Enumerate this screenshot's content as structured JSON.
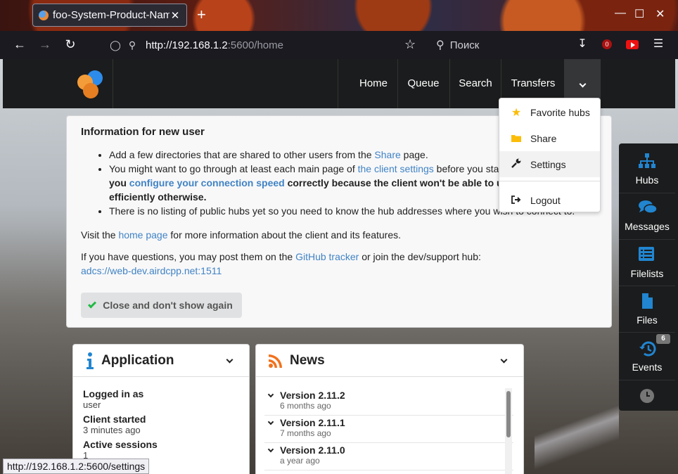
{
  "browser": {
    "tab_title": "foo-System-Product-Name",
    "close_tab": "✕",
    "new_tab": "+",
    "url_host": "http://192.168.1.2",
    "url_rest": ":5600/home",
    "search_placeholder": "Поиск",
    "status_url": "http://192.168.1.2:5600/settings",
    "ublock_count": "0"
  },
  "nav": {
    "items": [
      "Home",
      "Queue",
      "Search",
      "Transfers"
    ]
  },
  "dropdown": {
    "items": [
      {
        "label": "Favorite hubs",
        "icon": "star-icon"
      },
      {
        "label": "Share",
        "icon": "folder-icon"
      },
      {
        "label": "Settings",
        "icon": "wrench-icon"
      },
      {
        "label": "Logout",
        "icon": "sign-out-icon"
      }
    ]
  },
  "info": {
    "title": "Information for new user",
    "b1_pre": "Add a few directories that are shared to other users from the ",
    "b1_link": "Share",
    "b1_post": " page.",
    "b2_pre": "You might want to go through at least each main page of ",
    "b2_link": "the client settings",
    "b2_post": " before you start.",
    "b2_l2_pre": "you ",
    "b2_l2_link": "configure your connection speed",
    "b2_l2_post": " correctly because the client won't be able to utilize y",
    "b2_l3": "efficiently otherwise.",
    "b3_text": "There is no listing of public hubs yet so you need to know the hub addresses where you wish to connect to.",
    "visit_pre": "Visit the ",
    "visit_link": "home page",
    "visit_post": " for more information about the client and its features.",
    "q_pre": "If you have questions, you may post them on the ",
    "q_link": "GitHub tracker",
    "q_mid": " or join the dev/support hub: ",
    "q_hub": "adcs://web-dev.airdcpp.net:1511",
    "close_button": "Close and don't show again"
  },
  "sidebar": {
    "items": [
      {
        "label": "Hubs",
        "icon": "sitemap-icon"
      },
      {
        "label": "Messages",
        "icon": "comments-icon"
      },
      {
        "label": "Filelists",
        "icon": "list-icon"
      },
      {
        "label": "Files",
        "icon": "file-icon"
      },
      {
        "label": "Events",
        "icon": "history-icon",
        "badge": "6"
      }
    ]
  },
  "application": {
    "title": "Application",
    "rows": [
      {
        "key": "Logged in as",
        "value": "user"
      },
      {
        "key": "Client started",
        "value": "3 minutes ago"
      },
      {
        "key": "Active sessions",
        "value": "1"
      }
    ]
  },
  "news": {
    "title": "News",
    "items": [
      {
        "version": "Version 2.11.2",
        "age": "6 months ago"
      },
      {
        "version": "Version 2.11.1",
        "age": "7 months ago"
      },
      {
        "version": "Version 2.11.0",
        "age": "a year ago"
      }
    ]
  },
  "colors": {
    "accent": "#2185d0",
    "link": "#4183c4",
    "menu_bg": "#1b1c1d"
  }
}
